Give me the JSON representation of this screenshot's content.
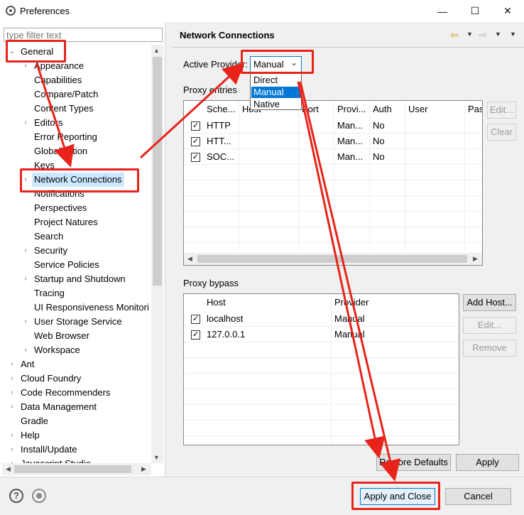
{
  "window": {
    "title": "Preferences"
  },
  "filter": {
    "placeholder": "type filter text"
  },
  "tree": {
    "items": [
      {
        "label": "General",
        "twisty": "⌄"
      },
      {
        "label": "Appearance",
        "twisty": "›"
      },
      {
        "label": "Capabilities",
        "twisty": ""
      },
      {
        "label": "Compare/Patch",
        "twisty": ""
      },
      {
        "label": "Content Types",
        "twisty": ""
      },
      {
        "label": "Editors",
        "twisty": "›"
      },
      {
        "label": "Error Reporting",
        "twisty": ""
      },
      {
        "label": "Globalization",
        "twisty": ""
      },
      {
        "label": "Keys",
        "twisty": ""
      },
      {
        "label": "Network Connections",
        "twisty": "›"
      },
      {
        "label": "Notifications",
        "twisty": ""
      },
      {
        "label": "Perspectives",
        "twisty": ""
      },
      {
        "label": "Project Natures",
        "twisty": ""
      },
      {
        "label": "Search",
        "twisty": ""
      },
      {
        "label": "Security",
        "twisty": "›"
      },
      {
        "label": "Service Policies",
        "twisty": ""
      },
      {
        "label": "Startup and Shutdown",
        "twisty": "›"
      },
      {
        "label": "Tracing",
        "twisty": ""
      },
      {
        "label": "UI Responsiveness Monitori",
        "twisty": ""
      },
      {
        "label": "User Storage Service",
        "twisty": "›"
      },
      {
        "label": "Web Browser",
        "twisty": ""
      },
      {
        "label": "Workspace",
        "twisty": "›"
      },
      {
        "label": "Ant",
        "twisty": "›"
      },
      {
        "label": "Cloud Foundry",
        "twisty": "›"
      },
      {
        "label": "Code Recommenders",
        "twisty": "›"
      },
      {
        "label": "Data Management",
        "twisty": "›"
      },
      {
        "label": "Gradle",
        "twisty": ""
      },
      {
        "label": "Help",
        "twisty": "›"
      },
      {
        "label": "Install/Update",
        "twisty": "›"
      },
      {
        "label": "Javascript Studio",
        "twisty": "›"
      }
    ]
  },
  "page": {
    "title": "Network Connections",
    "active_provider_label": "Active Provider:",
    "active_provider_value": "Manual",
    "dropdown_options": [
      "Direct",
      "Manual",
      "Native"
    ],
    "proxy_entries_label": "Proxy entries",
    "proxy_columns": [
      "Sche...",
      "Host",
      "Port",
      "Provi...",
      "Auth",
      "User",
      "Pas"
    ],
    "proxy_rows": [
      {
        "scheme": "HTTP",
        "host": "",
        "port": "",
        "provider": "Man...",
        "auth": "No"
      },
      {
        "scheme": "HTT...",
        "host": "",
        "port": "",
        "provider": "Man...",
        "auth": "No"
      },
      {
        "scheme": "SOC...",
        "host": "",
        "port": "",
        "provider": "Man...",
        "auth": "No"
      }
    ],
    "edit_button": "Edit...",
    "clear_button": "Clear",
    "proxy_bypass_label": "Proxy bypass",
    "bypass_columns": [
      "Host",
      "Provider"
    ],
    "bypass_rows": [
      {
        "host": "localhost",
        "provider": "Manual"
      },
      {
        "host": "127.0.0.1",
        "provider": "Manual"
      }
    ],
    "add_host_button": "Add Host...",
    "bypass_edit_button": "Edit...",
    "remove_button": "Remove",
    "restore_defaults_button": "Restore Defaults",
    "apply_button": "Apply"
  },
  "footer": {
    "apply_close_button": "Apply and Close",
    "cancel_button": "Cancel",
    "help_glyph": "?"
  },
  "colors": {
    "annotation_red": "#e8231a",
    "selection_blue": "#0078d7"
  }
}
